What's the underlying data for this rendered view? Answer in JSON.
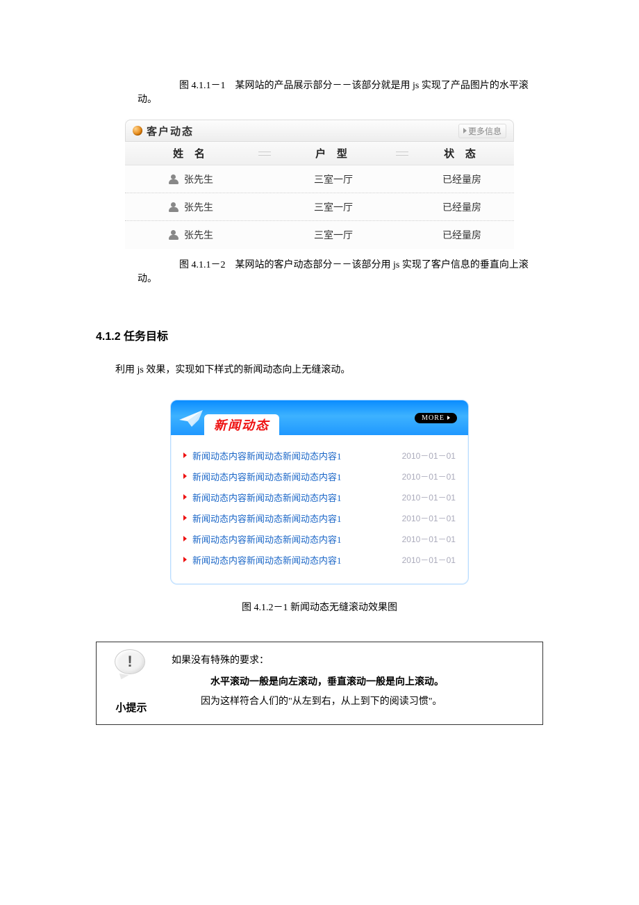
{
  "captions": {
    "c1": "图 4.1.1－1　某网站的产品展示部分－－该部分就是用 js 实现了产品图片的水平滚动。",
    "c2": "图 4.1.1－2　某网站的客户动态部分－－该部分用 js 实现了客户信息的垂直向上滚动。",
    "c3": "图  4.1.2－1  新闻动态无缝滚动效果图"
  },
  "customer_panel": {
    "title": "客户动态",
    "more": "更多信息",
    "columns": {
      "name": "姓 名",
      "type": "户 型",
      "status": "状 态"
    },
    "rows": [
      {
        "name": "张先生",
        "type": "三室一厅",
        "status": "已经量房"
      },
      {
        "name": "张先生",
        "type": "三室一厅",
        "status": "已经量房"
      },
      {
        "name": "张先生",
        "type": "三室一厅",
        "status": "已经量房"
      }
    ]
  },
  "section_heading": "4.1.2 任务目标",
  "task_paragraph": "利用 js 效果，实现如下样式的新闻动态向上无缝滚动。",
  "news_panel": {
    "title": "新闻动态",
    "more": "MORE",
    "items": [
      {
        "text": "新闻动态内容新闻动态新闻动态内容1",
        "date": "2010－01－01"
      },
      {
        "text": "新闻动态内容新闻动态新闻动态内容1",
        "date": "2010－01－01"
      },
      {
        "text": "新闻动态内容新闻动态新闻动态内容1",
        "date": "2010－01－01"
      },
      {
        "text": "新闻动态内容新闻动态新闻动态内容1",
        "date": "2010－01－01"
      },
      {
        "text": "新闻动态内容新闻动态新闻动态内容1",
        "date": "2010－01－01"
      },
      {
        "text": "新闻动态内容新闻动态新闻动态内容1",
        "date": "2010－01－01"
      }
    ]
  },
  "tip": {
    "label": "小提示",
    "line1": "如果没有特殊的要求：",
    "line2": "水平滚动一般是向左滚动，垂直滚动一般是向上滚动。",
    "line3": "因为这样符合人们的\"从左到右，从上到下的阅读习惯\"。"
  }
}
